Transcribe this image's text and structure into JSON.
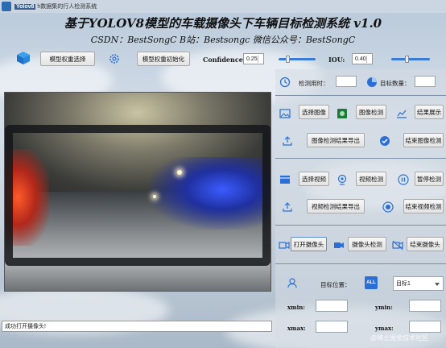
{
  "window": {
    "title_prefix": "Yolov8",
    "title": "h数据集的行人检测系统"
  },
  "header": {
    "main_title": "基于YOLOV8模型的车载摄像头下车辆目标检测系统 v1.0",
    "subtitle": "CSDN：BestSongC   B站：Bestsongc   微信公众号：BestSongC"
  },
  "toolbar": {
    "model_select_label": "模型权重选择",
    "model_init_label": "模型权重初始化",
    "confidence_label": "Confidence:",
    "confidence_value": "0.25",
    "iou_label": "IOU:",
    "iou_value": "0.40",
    "confidence_level": 0.25,
    "iou_level": 0.4
  },
  "stats": {
    "time_label": "检测用时：",
    "time_value": "",
    "count_label": "目标数量：",
    "count_value": ""
  },
  "image_section": {
    "select_label": "选择图像",
    "detect_label": "图像检测",
    "show_label": "结果展示",
    "export_label": "图像检测结果导出",
    "stop_label": "结束图像检测"
  },
  "video_section": {
    "select_label": "选择视频",
    "detect_label": "视频检测",
    "pause_label": "暂停检测",
    "export_label": "视频检测结果导出",
    "stop_label": "结束视频检测"
  },
  "camera_section": {
    "open_label": "打开摄像头",
    "detect_label": "摄像头检测",
    "stop_label": "结束摄像头"
  },
  "target": {
    "position_label": "目标位置：",
    "all_badge": "ALL",
    "selected": "目标1",
    "xmin_label": "xmin:",
    "ymin_label": "ymin:",
    "xmax_label": "xmax:",
    "ymax_label": "ymax:",
    "xmin": "",
    "ymin": "",
    "xmax": "",
    "ymax": ""
  },
  "status_text": "成功打开摄像头!",
  "watermark": "@稀土掘金技术社区",
  "colors": {
    "accent": "#3a7bd5",
    "primary_icon": "#2b6fd6"
  }
}
